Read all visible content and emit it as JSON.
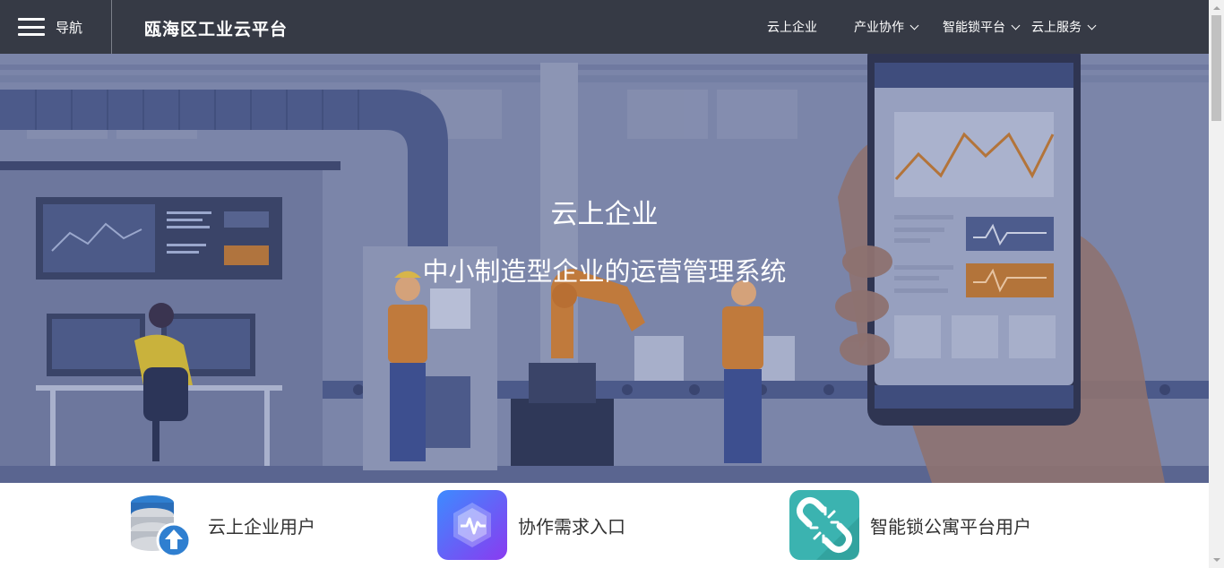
{
  "header": {
    "nav_label": "导航",
    "site_title": "瓯海区工业云平台",
    "menu": [
      {
        "label": "云上企业",
        "has_dropdown": false
      },
      {
        "label": "产业协作",
        "has_dropdown": true
      },
      {
        "label": "智能锁平台",
        "has_dropdown": true
      },
      {
        "label": "云上服务",
        "has_dropdown": true
      }
    ]
  },
  "hero": {
    "title": "云上企业",
    "subtitle": "中小制造型企业的运营管理系统"
  },
  "cards": [
    {
      "label": "云上企业用户",
      "icon": "database-upload-icon"
    },
    {
      "label": "协作需求入口",
      "icon": "pulse-hexagon-icon"
    },
    {
      "label": "智能锁公寓平台用户",
      "icon": "broken-link-icon"
    }
  ],
  "colors": {
    "topbar": "#363a45",
    "hero_overlay": "#7c86aa",
    "accent_orange": "#c07a3c",
    "card2_purple": "#6a4df5",
    "card3_teal": "#3bb3b0"
  }
}
